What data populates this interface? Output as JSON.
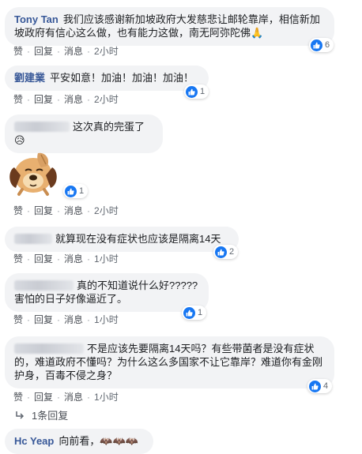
{
  "comments": [
    {
      "author": "Tony Tan",
      "text": "我们应该感谢新加坡政府大发慈悲让邮轮靠岸，相信新加坡政府有信心这么做，也有能力这做，南无阿弥陀佛🙏",
      "reactions": "6",
      "actions": {
        "like": "赞",
        "reply": "回复",
        "message": "消息",
        "time": "2小时"
      }
    },
    {
      "author": "劉建業",
      "text": "平安如意！加油！加油！加油！",
      "reactions": "1",
      "actions": {
        "like": "赞",
        "reply": "回复",
        "message": "消息",
        "time": "2小时"
      }
    },
    {
      "author": "",
      "text": "这次真的完蛋了😥",
      "reactions": "",
      "actions": {
        "like": "赞",
        "reply": "回复",
        "message": "消息",
        "time": "2小时"
      }
    },
    {
      "author": "",
      "text": "",
      "sticker": "crying-dog-sticker",
      "reactions": "1",
      "actions": {
        "like": "赞",
        "reply": "回复",
        "message": "消息",
        "time": "2小时"
      }
    },
    {
      "author": "",
      "text": "就算现在没有症状也应该是隔离14天",
      "reactions": "2",
      "actions": {
        "like": "赞",
        "reply": "回复",
        "message": "消息",
        "time": "1小时"
      }
    },
    {
      "author": "",
      "text": "真的不知道说什么好?????害怕的日子好像逼近了。",
      "reactions": "1",
      "actions": {
        "like": "赞",
        "reply": "回复",
        "message": "消息",
        "time": "1小时"
      }
    },
    {
      "author": "",
      "text": "不是应该先要隔离14天吗？有些带菌者是没有症状的，难道政府不懂吗？为什么这么多国家不让它靠岸？难道你有金刚护身，百毒不侵之身？",
      "reactions": "4",
      "actions": {
        "like": "赞",
        "reply": "回复",
        "message": "消息",
        "time": "1小时"
      }
    },
    {
      "author": "Hc Yeap",
      "text": "向前看，🦇🦇🦇",
      "reactions": "",
      "actions": {}
    }
  ],
  "replies_link": "1条回复",
  "colors": {
    "author": "#385898",
    "like": "#1877f2",
    "bubble": "#f2f3f5",
    "meta": "#606770"
  }
}
